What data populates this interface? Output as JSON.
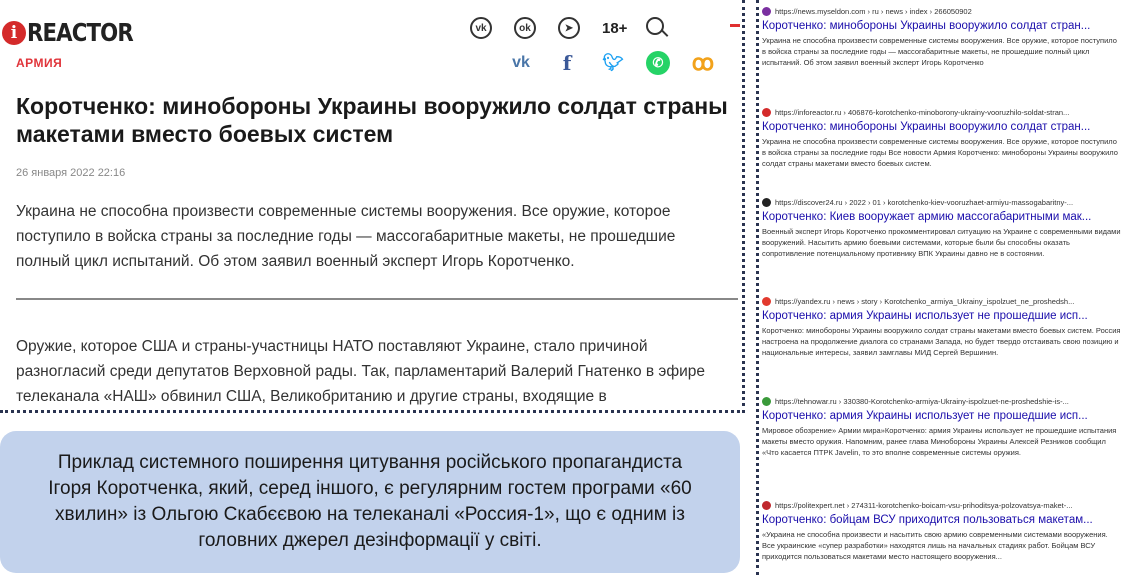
{
  "article": {
    "logo_letter": "i",
    "logo_text": "REACTOR",
    "age_rating": "18+",
    "section": "АРМИЯ",
    "title": "Коротченко: минобороны Украины вооружило солдат страны макетами вместо боевых систем",
    "date": "26 января 2022 22:16",
    "lead": "Украина не способна произвести современные системы вооружения. Все оружие, которое поступило в войска страны за последние годы — массогабаритные макеты, не прошедшие полный цикл испытаний. Об этом заявил военный эксперт Игорь Коротченко.",
    "body": "Оружие, которое США и страны-участницы НАТО поставляют Украине, стало причиной разногласий среди депутатов Верховной рады. Так, парламентарий Валерий Гнатенко в эфире телеканала «НАШ» обвинил США, Великобританию и другие страны, входящие в",
    "share_icons": [
      "vk-icon",
      "facebook-icon",
      "twitter-icon",
      "whatsapp-icon",
      "odnoklassniki-icon"
    ]
  },
  "caption": "Приклад системного поширення цитування російського пропагандиста Ігоря Коротченка, який, серед іншого, є регулярним гостем програми «60 хвилин» із Ольгою Скабєєвою на телеканалі «Россия-1», що є одним із головних джерел дезінформації у світі.",
  "results": [
    {
      "url": "https://news.myseldon.com › ru › news › index › 266050902",
      "title": "Коротченко: минобороны Украины вооружило солдат стран...",
      "snippet": "Украина не способна произвести современные системы вооружения. Все оружие, которое поступило в войска страны за последние годы — массогабаритные макеты, не прошедшие полный цикл испытаний. Об этом заявил военный эксперт Игорь Коротченко",
      "favicon_color": "#7a2fa0"
    },
    {
      "url": "https://inforeactor.ru › 406876-korotchenko-minoborony-ukrainy-vooruzhilo-soldat-stran...",
      "title": "Коротченко: минобороны Украины вооружило солдат стран...",
      "snippet": "Украина не способна произвести современные системы вооружения. Все оружие, которое поступило в войска страны за последние годы Все новости Армия Коротченко: минобороны Украины вооружило солдат страны макетами вместо боевых систем.",
      "favicon_color": "#d42a2a"
    },
    {
      "url": "https://discover24.ru › 2022 › 01 › korotchenko-kiev-vooruzhaet-armiyu-massogabaritny-...",
      "title": "Коротченко: Киев вооружает армию массогабаритными мак...",
      "snippet": "Военный эксперт Игорь Коротченко прокомментировал ситуацию на Украине с современными видами вооружений. Насытить армию боевыми системами, которые были бы способны оказать сопротивление потенциальному противнику ВПК Украины давно не в состоянии.",
      "favicon_color": "#222222"
    },
    {
      "url": "https://yandex.ru › news › story › Korotchenko_armiya_Ukrainy_ispolzuet_ne_proshedsh...",
      "title": "Коротченко: армия Украины использует не прошедшие исп...",
      "snippet": "Коротченко: минобороны Украины вооружило солдат страны макетами вместо боевых систем. Россия настроена на продолжение диалога со странами Запада, но будет твердо отстаивать свою позицию и национальные интересы, заявил замглавы МИД Сергей Вершинин.",
      "favicon_color": "#e23a2e"
    },
    {
      "url": "https://tehnowar.ru › 330380-Korotchenko-armiya-Ukrainy-ispolzuet-ne-proshedshie-is-...",
      "title": "Коротченко: армия Украины использует не прошедшие исп...",
      "snippet": "Мировое обозрение» Армии мира»Коротченко: армия Украины использует не прошедшие испытания макеты вместо оружия. Напомним, ранее глава Минобороны Украины Алексей Резников сообщил «Что касается ПТРК Javelin, то это вполне современные системы оружия.",
      "favicon_color": "#3a9a3a"
    },
    {
      "url": "https://politexpert.net › 274311-korotchenko-boicam-vsu-prihoditsya-polzovatsya-maket-...",
      "title": "Коротченко: бойцам ВСУ приходится пользоваться макетам...",
      "snippet": "«Украина не способна произвести и насытить свою армию современными системами вооружения. Все украинские «супер разработки» находятся лишь на начальных стадиях работ. Бойцам ВСУ приходится пользоваться макетами место настоящего вооружения...",
      "favicon_color": "#c0282d"
    }
  ]
}
